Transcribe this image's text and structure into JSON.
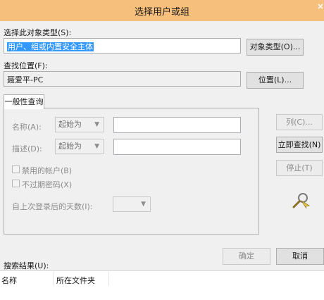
{
  "window": {
    "title": "选择用户或组",
    "close_glyph": "×"
  },
  "object_type": {
    "label": "选择此对象类型(S):",
    "value": "用户、组或内置安全主体",
    "button": "对象类型(O)..."
  },
  "location": {
    "label": "查找位置(F):",
    "value": "聂爱平-PC",
    "button": "位置(L)..."
  },
  "tabs": [
    {
      "label": "一般性查询"
    }
  ],
  "query": {
    "name_label": "名称(A):",
    "name_mode": "起始为",
    "desc_label": "描述(D):",
    "desc_mode": "起始为",
    "disabled_accounts": "禁用的帐户(B)",
    "non_expiring": "不过期密码(X)",
    "days_label": "自上次登录后的天数(I):"
  },
  "side_buttons": {
    "columns": "列(C)...",
    "find_now": "立即查找(N)",
    "stop": "停止(T)"
  },
  "footer_buttons": {
    "ok": "确定",
    "cancel": "取消"
  },
  "results": {
    "label": "搜索结果(U):",
    "columns": [
      "名称",
      "所在文件夹"
    ]
  },
  "icons": {
    "search": "search-icon"
  }
}
